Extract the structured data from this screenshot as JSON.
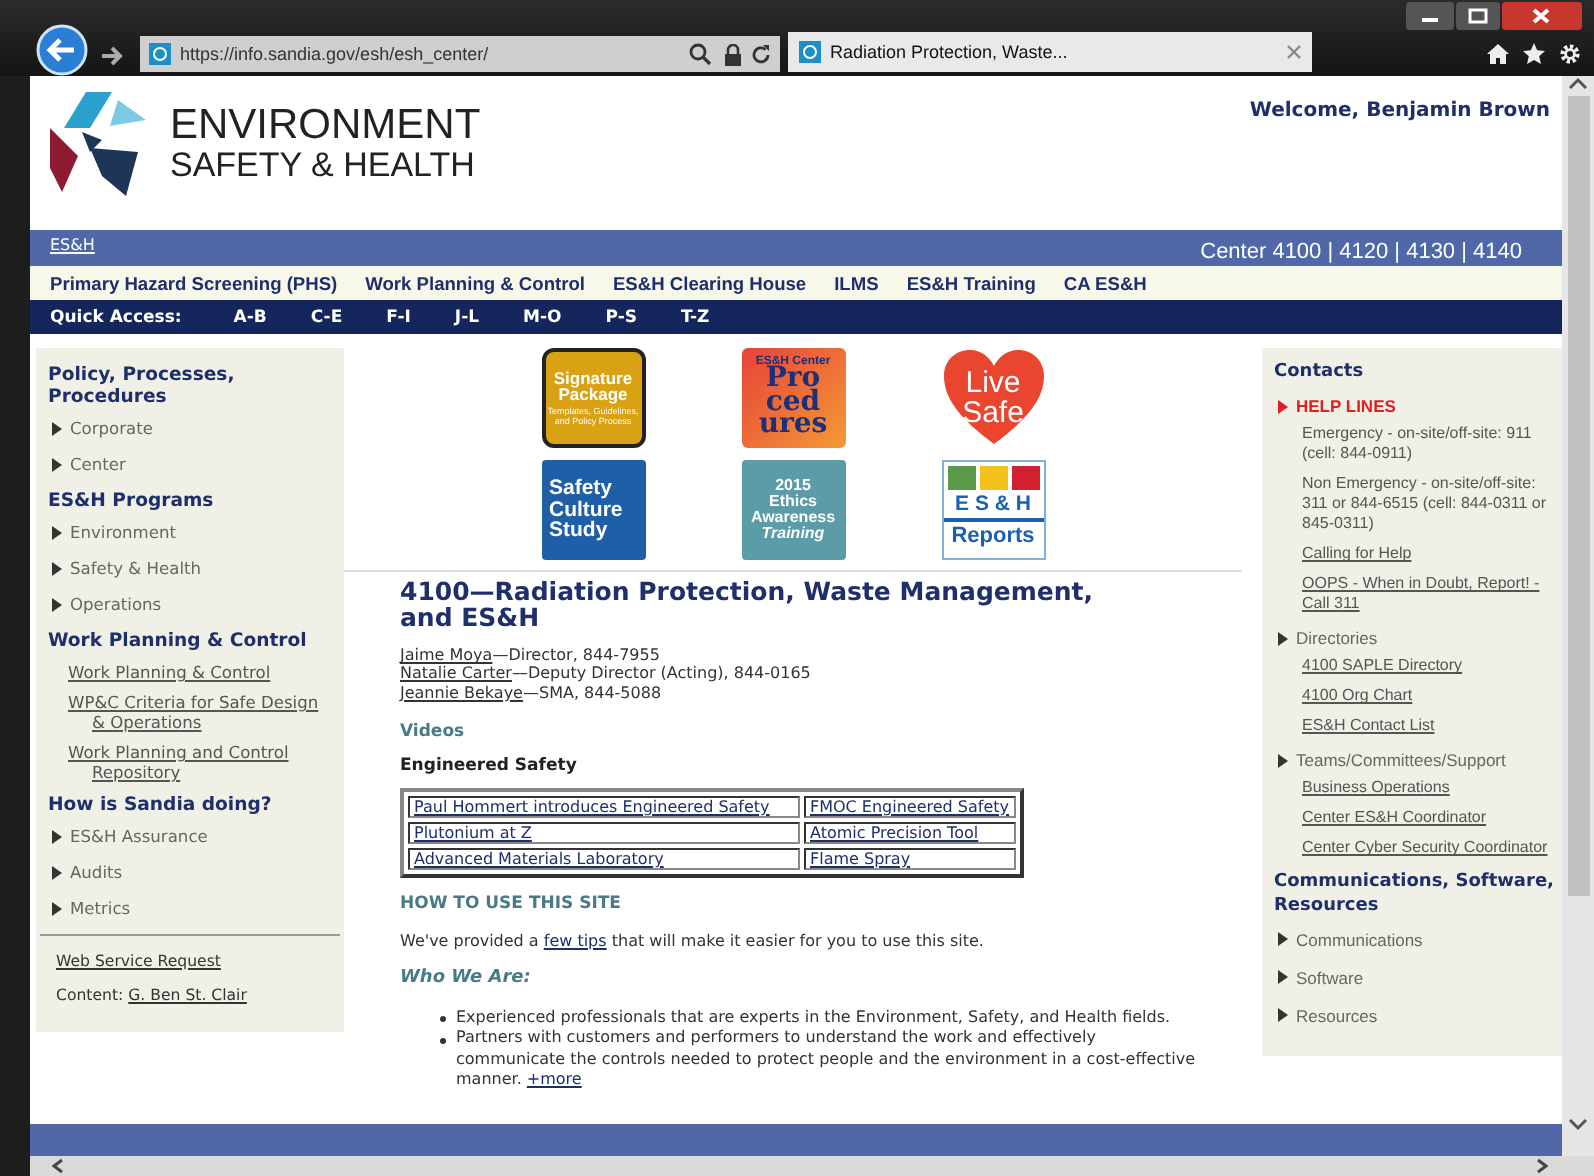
{
  "browser": {
    "url": "https://info.sandia.gov/esh/esh_center/",
    "tab_title": "Radiation Protection, Waste..."
  },
  "header": {
    "logo_lines": [
      "ENVIRONMENT",
      "SAFETY & HEALTH"
    ],
    "welcome": "Welcome, Benjamin Brown"
  },
  "top_bar": {
    "link": "ES&H",
    "centers": "Center 4100 | 4120 | 4130 | 4140"
  },
  "nav": [
    "Primary Hazard Screening (PHS)",
    "Work Planning & Control",
    "ES&H Clearing House",
    "ILMS",
    "ES&H Training",
    "CA ES&H"
  ],
  "quick_access": {
    "label": "Quick Access:",
    "items": [
      "A-B",
      "C-E",
      "F-I",
      "J-L",
      "M-O",
      "P-S",
      "T-Z"
    ]
  },
  "left_sidebar": {
    "sections": [
      {
        "title": "Policy, Processes, Procedures",
        "items": [
          {
            "kind": "arrow",
            "label": "Corporate"
          },
          {
            "kind": "arrow",
            "label": "Center"
          }
        ]
      },
      {
        "title": "ES&H Programs",
        "items": [
          {
            "kind": "arrow",
            "label": "Environment"
          },
          {
            "kind": "arrow",
            "label": "Safety & Health"
          },
          {
            "kind": "arrow",
            "label": "Operations"
          }
        ]
      },
      {
        "title": "Work Planning & Control",
        "items": [
          {
            "kind": "link",
            "label": "Work Planning & Control"
          },
          {
            "kind": "link",
            "label": "WP&C Criteria for Safe Design & Operations"
          },
          {
            "kind": "link",
            "label": "Work Planning and Control Repository"
          }
        ]
      },
      {
        "title": "How is Sandia doing?",
        "items": [
          {
            "kind": "arrow",
            "label": "ES&H Assurance"
          },
          {
            "kind": "arrow",
            "label": "Audits"
          },
          {
            "kind": "arrow",
            "label": "Metrics"
          }
        ]
      }
    ],
    "request_link": "Web Service Request",
    "content_label": "Content:",
    "content_link": "G. Ben St. Clair"
  },
  "tiles": [
    {
      "kind": "signature",
      "lines": [
        "Signature",
        "Package"
      ],
      "caption": "Templates, Guidelines, and Policy Process"
    },
    {
      "kind": "procedures",
      "lines": [
        "Pro",
        "ced",
        "ures"
      ],
      "caption": "ES&H Center"
    },
    {
      "kind": "livesafe",
      "lines": [
        "Live",
        "Safe"
      ]
    },
    {
      "kind": "culture",
      "lines": [
        "Safety",
        "Culture",
        "Study"
      ]
    },
    {
      "kind": "ethics",
      "lines": [
        "2015",
        "Ethics",
        "Awareness",
        "Training"
      ]
    },
    {
      "kind": "reports",
      "lines": [
        "E S & H",
        "Reports"
      ]
    }
  ],
  "heading": "4100—Radiation Protection, Waste Management, and ES&H",
  "staff": [
    {
      "name": "Jaime Moya",
      "detail": "—Director, 844-7955"
    },
    {
      "name": "Natalie Carter",
      "detail": "—Deputy Director (Acting), 844-0165"
    },
    {
      "name": "Jeannie Bekaye",
      "detail": "—SMA, 844-5088"
    }
  ],
  "videos": {
    "title": "Videos",
    "subtitle": "Engineered Safety",
    "rows": [
      [
        "Paul Hommert introduces Engineered Safety",
        "FMOC Engineered Safety"
      ],
      [
        "Plutonium at Z",
        "Atomic Precision Tool"
      ],
      [
        "Advanced Materials Laboratory",
        "Flame Spray"
      ]
    ]
  },
  "how_to": {
    "title": "HOW TO USE THIS SITE",
    "before": "We've provided a ",
    "link": "few tips",
    "after": " that will make it easier for you to use this site."
  },
  "who_we_are": {
    "title": "Who We Are:",
    "bullets": [
      {
        "text": "Experienced professionals that are experts in the Environment, Safety, and Health fields."
      },
      {
        "text": "Partners with customers and performers to understand the work and effectively communicate the controls needed to protect people and the environment in a cost-effective manner. ",
        "link": "+more"
      }
    ]
  },
  "right_sidebar": {
    "title": "Contacts",
    "groups": [
      {
        "kind": "alert",
        "label": "HELP LINES",
        "entries": [
          {
            "kind": "text",
            "text": "Emergency - on-site/off-site: 911 (cell: 844-0911)"
          },
          {
            "kind": "text",
            "text": "Non Emergency - on-site/off-site: 311 or 844-6515 (cell: 844-0311 or 845-0311)"
          },
          {
            "kind": "link",
            "text": "Calling for Help"
          },
          {
            "kind": "link",
            "text": "OOPS - When in Doubt, Report! - Call 311"
          }
        ]
      },
      {
        "kind": "arrow",
        "label": "Directories",
        "entries": [
          {
            "kind": "link",
            "text": "4100 SAPLE Directory"
          },
          {
            "kind": "link",
            "text": "4100 Org Chart"
          },
          {
            "kind": "link",
            "text": "ES&H Contact List"
          }
        ]
      },
      {
        "kind": "arrow",
        "label": "Teams/Committees/Support",
        "entries": [
          {
            "kind": "link",
            "text": "Business Operations"
          },
          {
            "kind": "link",
            "text": "Center ES&H Coordinator"
          },
          {
            "kind": "link",
            "text": "Center Cyber Security Coordinator"
          }
        ]
      }
    ],
    "resources_title": "Communications, Software, Resources",
    "resources": [
      "Communications",
      "Software",
      "Resources"
    ]
  }
}
